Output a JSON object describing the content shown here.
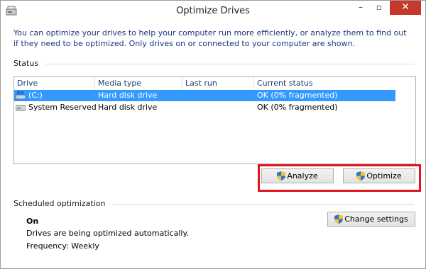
{
  "window": {
    "title": "Optimize Drives",
    "close_glyph": "✕",
    "minimize_glyph": "–",
    "maximize_glyph": "▫"
  },
  "description": "You can optimize your drives to help your computer run more efficiently, or analyze them to find out if they need to be optimized. Only drives on or connected to your computer are shown.",
  "status": {
    "label": "Status",
    "columns": [
      "Drive",
      "Media type",
      "Last run",
      "Current status"
    ],
    "rows": [
      {
        "drive": "(C:)",
        "media_type": "Hard disk drive",
        "last_run": "",
        "current_status": "OK (0% fragmented)",
        "selected": true,
        "icon": "windows-drive-icon"
      },
      {
        "drive": "System Reserved",
        "media_type": "Hard disk drive",
        "last_run": "",
        "current_status": "OK (0% fragmented)",
        "selected": false,
        "icon": "hard-drive-icon"
      }
    ]
  },
  "actions": {
    "analyze_label": "Analyze",
    "optimize_label": "Optimize"
  },
  "scheduled": {
    "label": "Scheduled optimization",
    "state": "On",
    "detail": "Drives are being optimized automatically.",
    "frequency": "Frequency: Weekly",
    "change_settings_label": "Change settings"
  },
  "colors": {
    "selection": "#3399ff",
    "highlight": "#e0151e",
    "close": "#c7382c"
  }
}
